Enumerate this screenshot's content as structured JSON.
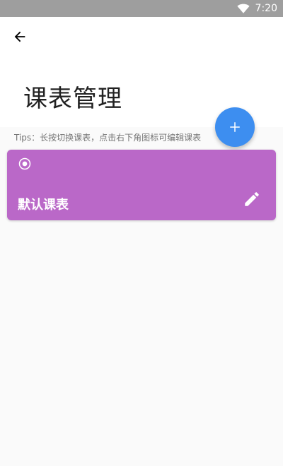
{
  "status_bar": {
    "time": "7:20",
    "wifi_icon": "wifi-icon"
  },
  "toolbar": {
    "back_icon": "arrow-back-icon"
  },
  "header": {
    "title": "课表管理"
  },
  "tips": "Tips：长按切换课表，点击右下角图标可编辑课表",
  "fab": {
    "icon": "plus-icon",
    "color": "#3d8ef0"
  },
  "schedules": [
    {
      "name": "默认课表",
      "selected": true,
      "color": "#ba68c8",
      "edit_icon": "pencil-icon"
    }
  ]
}
